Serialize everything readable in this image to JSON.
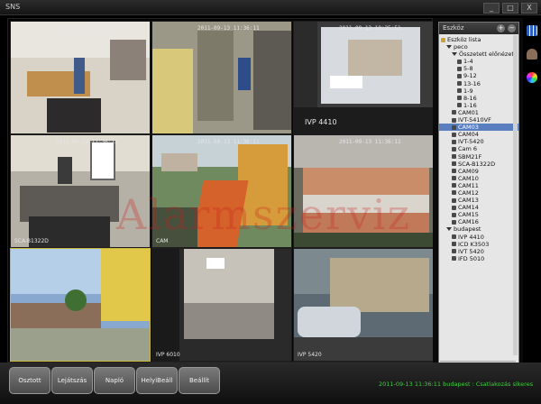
{
  "window": {
    "title": "SNS",
    "btn_min": "_",
    "btn_max": "□",
    "btn_close": "X"
  },
  "cameras": [
    {
      "timestamp": "2011-09-13 11:36:11",
      "label": ""
    },
    {
      "timestamp": "2011-09-13 11:36:11",
      "label": ""
    },
    {
      "timestamp": "2011-09-13 10:25:51",
      "label": "IVP 4410"
    },
    {
      "timestamp": "2011-09-13 11:36:11",
      "label": "SCA-B1322D"
    },
    {
      "timestamp": "2011-09-13 11:36:11",
      "label": "CAM"
    },
    {
      "timestamp": "2011-09-13 11:36:11",
      "label": ""
    },
    {
      "timestamp": "",
      "label": ""
    },
    {
      "timestamp": "",
      "label": "IVP 6010"
    },
    {
      "timestamp": "",
      "label": "IVP 5420"
    }
  ],
  "panel": {
    "header": "Eszköz",
    "plus": "+",
    "minus": "−",
    "tree": [
      {
        "text": "Eszköz lista",
        "indent": 0,
        "kind": "grp"
      },
      {
        "text": "peco",
        "indent": 1,
        "kind": "arr"
      },
      {
        "text": "Összetett előnézet",
        "indent": 2,
        "kind": "arr"
      },
      {
        "text": "1-4",
        "indent": 3,
        "kind": "cam"
      },
      {
        "text": "5-8",
        "indent": 3,
        "kind": "cam"
      },
      {
        "text": "9-12",
        "indent": 3,
        "kind": "cam"
      },
      {
        "text": "13-16",
        "indent": 3,
        "kind": "cam"
      },
      {
        "text": "1-9",
        "indent": 3,
        "kind": "cam"
      },
      {
        "text": "8-16",
        "indent": 3,
        "kind": "cam"
      },
      {
        "text": "1-16",
        "indent": 3,
        "kind": "cam"
      },
      {
        "text": "CAM01",
        "indent": 2,
        "kind": "cam"
      },
      {
        "text": "IVT-5410VF",
        "indent": 2,
        "kind": "cam"
      },
      {
        "text": "CAM03",
        "indent": 2,
        "kind": "cam",
        "hl": true
      },
      {
        "text": "CAM04",
        "indent": 2,
        "kind": "cam"
      },
      {
        "text": "IVT-5420",
        "indent": 2,
        "kind": "cam"
      },
      {
        "text": "Cam 6",
        "indent": 2,
        "kind": "cam"
      },
      {
        "text": "SBM21F",
        "indent": 2,
        "kind": "cam"
      },
      {
        "text": "SCA-B1322D",
        "indent": 2,
        "kind": "cam"
      },
      {
        "text": "CAM09",
        "indent": 2,
        "kind": "cam"
      },
      {
        "text": "CAM10",
        "indent": 2,
        "kind": "cam"
      },
      {
        "text": "CAM11",
        "indent": 2,
        "kind": "cam"
      },
      {
        "text": "CAM12",
        "indent": 2,
        "kind": "cam"
      },
      {
        "text": "CAM13",
        "indent": 2,
        "kind": "cam"
      },
      {
        "text": "CAM14",
        "indent": 2,
        "kind": "cam"
      },
      {
        "text": "CAM15",
        "indent": 2,
        "kind": "cam"
      },
      {
        "text": "CAM16",
        "indent": 2,
        "kind": "cam"
      },
      {
        "text": "budapest",
        "indent": 1,
        "kind": "arr"
      },
      {
        "text": "IVP 4410",
        "indent": 2,
        "kind": "cam"
      },
      {
        "text": "ICD K3503",
        "indent": 2,
        "kind": "cam"
      },
      {
        "text": "IVT 5420",
        "indent": 2,
        "kind": "cam"
      },
      {
        "text": "IFD 5010",
        "indent": 2,
        "kind": "cam"
      }
    ]
  },
  "buttons": [
    "Osztott",
    "Lejátszás",
    "Napló",
    "HelyiBeáll",
    "Beállít"
  ],
  "status": "2011-09-13   11:36:11   budapest : Csatlakozás sikeres",
  "watermark": "Alarmszerviz",
  "colors": {
    "accent_selected": "#c9b73e",
    "status_text": "#3ecf3e"
  }
}
